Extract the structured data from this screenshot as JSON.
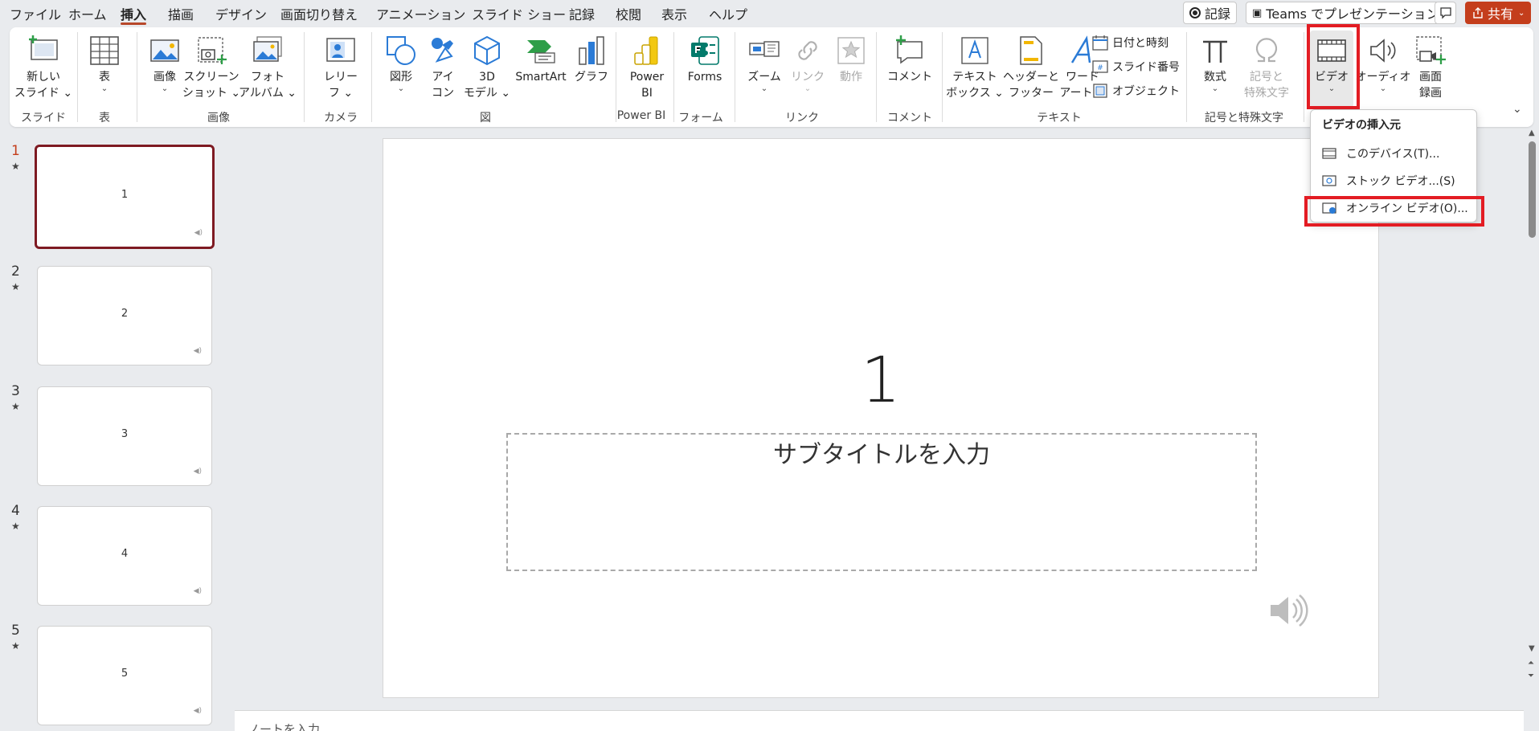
{
  "menubar": {
    "tabs": [
      "ファイル",
      "ホーム",
      "挿入",
      "描画",
      "デザイン",
      "画面切り替え",
      "アニメーション",
      "スライド ショー",
      "記録",
      "校閲",
      "表示",
      "ヘルプ"
    ],
    "active_tab": "挿入",
    "record_button": "記録",
    "teams_button": "Teams でプレゼンテーション",
    "share_button": "共有"
  },
  "ribbon": {
    "new_slide": [
      "新しい",
      "スライド"
    ],
    "table": "表",
    "image": "画像",
    "screenshot": [
      "スクリーン",
      "ショット"
    ],
    "photo_album": [
      "フォト",
      "アルバム"
    ],
    "cameo": [
      "レリー",
      "フ"
    ],
    "shapes": "図形",
    "icons": [
      "アイ",
      "コン"
    ],
    "models_3d": [
      "3D",
      "モデル"
    ],
    "smartart": "SmartArt",
    "chart": "グラフ",
    "power_bi": [
      "Power",
      "BI"
    ],
    "forms": "Forms",
    "zoom": "ズーム",
    "link": "リンク",
    "action": "動作",
    "comment": "コメント",
    "textbox": [
      "テキスト",
      "ボックス"
    ],
    "header_footer": [
      "ヘッダーと",
      "フッター"
    ],
    "wordart": [
      "ワード",
      "アート"
    ],
    "date_time": "日付と時刻",
    "slide_number": "スライド番号",
    "object": "オブジェクト",
    "equation": "数式",
    "symbol": [
      "記号と",
      "特殊文字"
    ],
    "video": "ビデオ",
    "audio": "オーディオ",
    "screen_recording": [
      "画面",
      "録画"
    ],
    "groups": {
      "slides": "スライド",
      "tables": "表",
      "images": "画像",
      "camera": "カメラ",
      "illustrations": "図",
      "power_bi": "Power BI",
      "forms": "フォーム",
      "links": "リンク",
      "comments": "コメント",
      "text": "テキスト",
      "symbols": "記号と特殊文字"
    }
  },
  "video_menu": {
    "header": "ビデオの挿入元",
    "items": [
      "このデバイス(T)...",
      "ストック ビデオ...(S)",
      "オンライン ビデオ(O)..."
    ]
  },
  "slides": [
    {
      "number": "1",
      "title": "1"
    },
    {
      "number": "2",
      "title": "2"
    },
    {
      "number": "3",
      "title": "3"
    },
    {
      "number": "4",
      "title": "4"
    },
    {
      "number": "5",
      "title": "5"
    }
  ],
  "main_slide": {
    "title": "1",
    "subtitle_placeholder": "サブタイトルを入力"
  },
  "notes_placeholder": "ノートを入力",
  "colors": {
    "accent": "#c43e1c",
    "highlight": "#e31c23",
    "active_thumb_border": "#7e1a22"
  }
}
